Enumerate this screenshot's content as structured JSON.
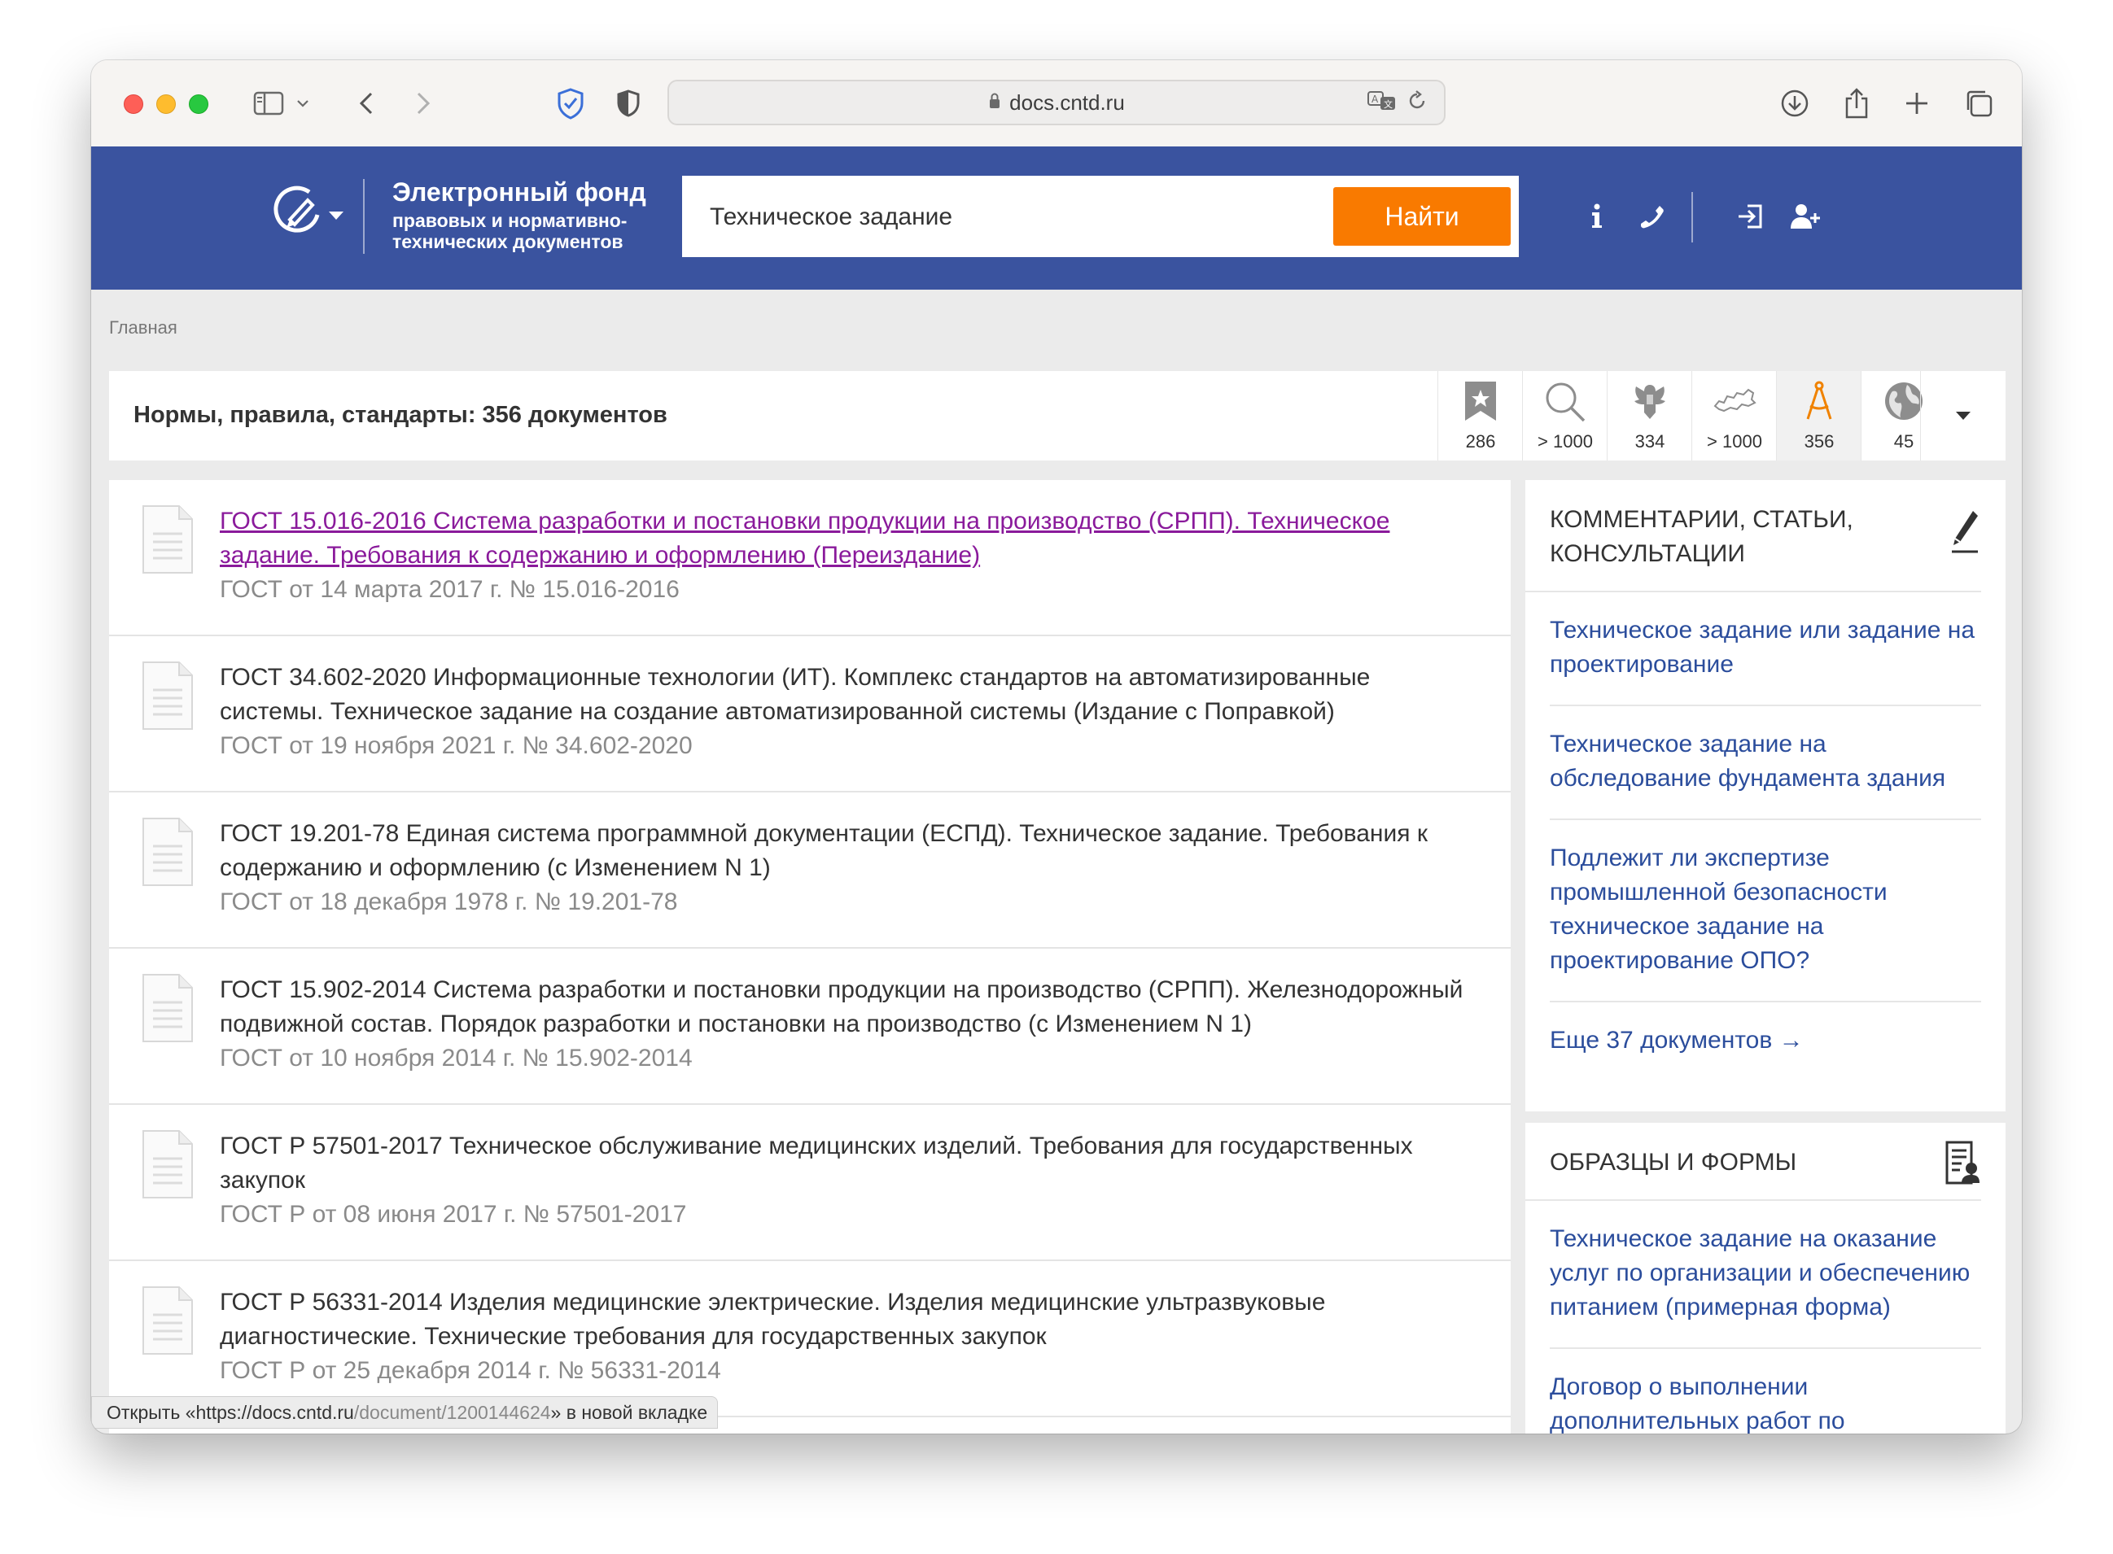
{
  "browser": {
    "url": "docs.cntd.ru"
  },
  "header": {
    "logo_title": "Электронный фонд",
    "logo_subtitle_1": "правовых и нормативно-",
    "logo_subtitle_2": "технических документов",
    "search_value": "Техническое задание",
    "search_button": "Найти"
  },
  "breadcrumb": "Главная",
  "summary": {
    "title": "Нормы, правила, стандарты: 356 документов",
    "filters": [
      {
        "icon": "bookmark-star-icon",
        "count": "286"
      },
      {
        "icon": "magnifier-icon",
        "count": "> 1000"
      },
      {
        "icon": "russia-emblem-icon",
        "count": "334"
      },
      {
        "icon": "russia-map-icon",
        "count": "> 1000"
      },
      {
        "icon": "compass-icon",
        "count": "356"
      },
      {
        "icon": "globe-icon",
        "count": "45"
      }
    ]
  },
  "results": [
    {
      "title": "ГОСТ 15.016-2016 Система разработки и постановки продукции на производство (СРПП). Техническое задание. Требования к содержанию и оформлению (Переиздание)",
      "meta": "ГОСТ от 14 марта 2017 г. № 15.016-2016",
      "visited": true
    },
    {
      "title": "ГОСТ 34.602-2020 Информационные технологии (ИТ). Комплекс стандартов на автоматизированные системы. Техническое задание на создание автоматизированной системы (Издание с Поправкой)",
      "meta": "ГОСТ от 19 ноября 2021 г. № 34.602-2020",
      "visited": false
    },
    {
      "title": "ГОСТ 19.201-78 Единая система программной документации (ЕСПД). Техническое задание. Требования к содержанию и оформлению (с Изменением N 1)",
      "meta": "ГОСТ от 18 декабря 1978 г. № 19.201-78",
      "visited": false
    },
    {
      "title": "ГОСТ 15.902-2014 Система разработки и постановки продукции на производство (СРПП). Железнодорожный подвижной состав. Порядок разработки и постановки на производство (с Изменением N 1)",
      "meta": "ГОСТ от 10 ноября 2014 г. № 15.902-2014",
      "visited": false
    },
    {
      "title": "ГОСТ Р 57501-2017 Техническое обслуживание медицинских изделий. Требования для государственных закупок",
      "meta": "ГОСТ Р от 08 июня 2017 г. № 57501-2017",
      "visited": false
    },
    {
      "title": "ГОСТ Р 56331-2014 Изделия медицинские электрические. Изделия медицинские ультразвуковые диагностические. Технические требования для государственных закупок",
      "meta": "ГОСТ Р от 25 декабря 2014 г. № 56331-2014",
      "visited": false
    }
  ],
  "sidebar": {
    "comments": {
      "title": "КОММЕНТАРИИ, СТАТЬИ, КОНСУЛЬТАЦИИ",
      "items": [
        "Техническое задание или задание на проектирование",
        "Техническое задание на обследование фундамента здания",
        "Подлежит ли экспертизе промышленной безопасности техническое задание на проектирование ОПО?"
      ],
      "more": "Еще 37 документов →"
    },
    "forms": {
      "title": "ОБРАЗЦЫ И ФОРМЫ",
      "items": [
        "Техническое задание на оказание услуг по организации и обеспечению питанием (примерная форма)",
        "Договор о выполнении дополнительных работ по проведению"
      ]
    }
  },
  "status": {
    "prefix": "Открыть «https://docs.cntd.ru",
    "path": "/document/1200144624",
    "suffix": "» в новой вкладке"
  },
  "colors": {
    "header_bg": "#3a539f",
    "search_button": "#f97a00",
    "link": "#2b4d9c",
    "visited_link": "#8a1a9b"
  }
}
